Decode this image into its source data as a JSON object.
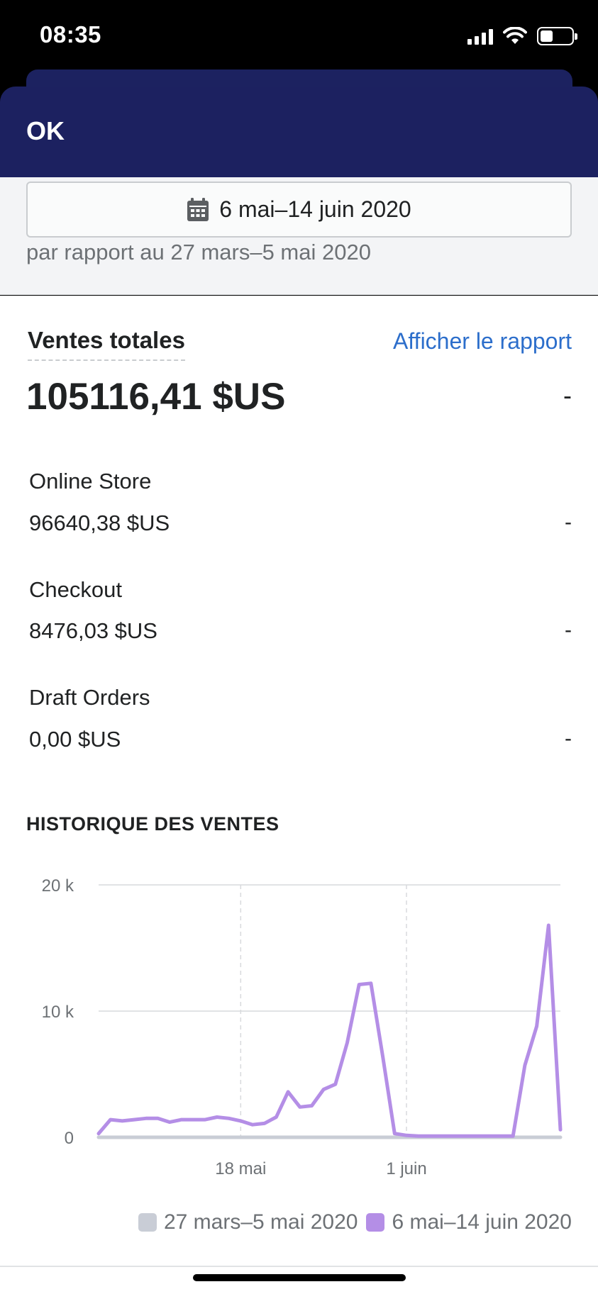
{
  "status_bar": {
    "time": "08:35",
    "battery_level": 0.4
  },
  "nav": {
    "ok_label": "OK"
  },
  "date_range": {
    "icon": "calendar-icon",
    "label": "6 mai–14 juin 2020",
    "comparison": "par rapport au 27 mars–5 mai 2020"
  },
  "total_sales": {
    "title": "Ventes totales",
    "report_link": "Afficher le rapport",
    "value": "105116,41 $US",
    "change": "-"
  },
  "channels": [
    {
      "name": "Online Store",
      "value": "96640,38 $US",
      "change": "-"
    },
    {
      "name": "Checkout",
      "value": "8476,03 $US",
      "change": "-"
    },
    {
      "name": "Draft Orders",
      "value": "0,00 $US",
      "change": "-"
    }
  ],
  "colors": {
    "nav": "#1c2160",
    "current_series": "#b48ee6",
    "previous_series": "#c9cdd6",
    "link": "#2c6ecb"
  },
  "chart_data": {
    "type": "line",
    "title": "HISTORIQUE DES VENTES",
    "y_ticks": [
      "0",
      "10 k",
      "20 k"
    ],
    "ylim": [
      0,
      20000
    ],
    "x_ticks": [
      {
        "label": "18 mai",
        "day_index": 12
      },
      {
        "label": "1 juin",
        "day_index": 26
      }
    ],
    "x_range_days": [
      0,
      39
    ],
    "grid": true,
    "legend_position": "bottom-right",
    "series": [
      {
        "name": "27 mars–5 mai 2020",
        "color": "#c9cdd6",
        "values": [
          0,
          0,
          0,
          0,
          0,
          0,
          0,
          0,
          0,
          0,
          0,
          0,
          0,
          0,
          0,
          0,
          0,
          0,
          0,
          0,
          0,
          0,
          0,
          0,
          0,
          0,
          0,
          0,
          0,
          0,
          0,
          0,
          0,
          0,
          0,
          0,
          0,
          0,
          0,
          0
        ]
      },
      {
        "name": "6 mai–14 juin 2020",
        "color": "#b48ee6",
        "values": [
          300,
          1400,
          1300,
          1400,
          1500,
          1500,
          1200,
          1400,
          1400,
          1400,
          1600,
          1500,
          1300,
          1000,
          1100,
          1600,
          3600,
          2400,
          2500,
          3800,
          4200,
          7500,
          12100,
          12200,
          6400,
          300,
          150,
          100,
          100,
          100,
          100,
          100,
          100,
          100,
          100,
          100,
          5700,
          8800,
          16800,
          600
        ]
      }
    ]
  },
  "legend": {
    "previous": "27 mars–5 mai 2020",
    "current": "6 mai–14 juin 2020"
  }
}
